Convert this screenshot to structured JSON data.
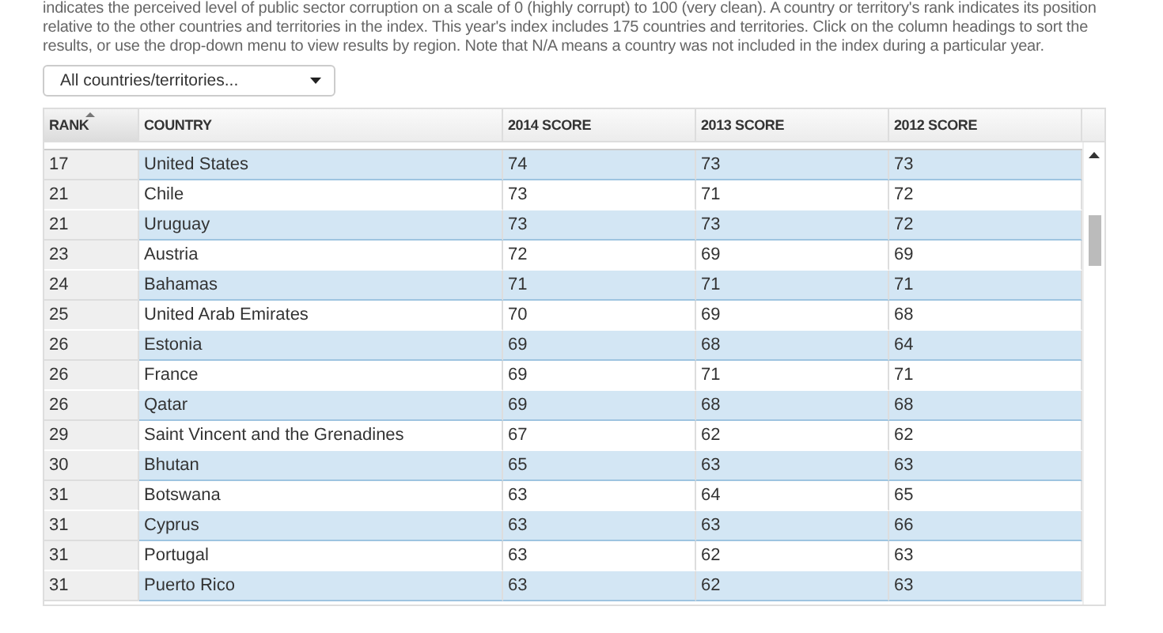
{
  "intro": "indicates the perceived level of public sector corruption on a scale of 0 (highly corrupt) to 100 (very clean). A country or territory's rank indicates its position relative to the other countries and territories in the index. This year's index includes 175 countries and territories. Click on the column headings to sort the results, or use the drop-down menu to view results by region. Note that N/A means a country was not included in the index during a particular year.",
  "region_select": {
    "value": "All countries/territories..."
  },
  "table": {
    "columns": [
      {
        "label": "RANK",
        "sorted": true
      },
      {
        "label": "COUNTRY",
        "sorted": false
      },
      {
        "label": "2014 SCORE",
        "sorted": false
      },
      {
        "label": "2013 SCORE",
        "sorted": false
      },
      {
        "label": "2012 SCORE",
        "sorted": false
      }
    ],
    "rows": [
      [
        "17",
        "United States",
        "74",
        "73",
        "73"
      ],
      [
        "21",
        "Chile",
        "73",
        "71",
        "72"
      ],
      [
        "21",
        "Uruguay",
        "73",
        "73",
        "72"
      ],
      [
        "23",
        "Austria",
        "72",
        "69",
        "69"
      ],
      [
        "24",
        "Bahamas",
        "71",
        "71",
        "71"
      ],
      [
        "25",
        "United Arab Emirates",
        "70",
        "69",
        "68"
      ],
      [
        "26",
        "Estonia",
        "69",
        "68",
        "64"
      ],
      [
        "26",
        "France",
        "69",
        "71",
        "71"
      ],
      [
        "26",
        "Qatar",
        "69",
        "68",
        "68"
      ],
      [
        "29",
        "Saint Vincent and the Grenadines",
        "67",
        "62",
        "62"
      ],
      [
        "30",
        "Bhutan",
        "65",
        "63",
        "63"
      ],
      [
        "31",
        "Botswana",
        "63",
        "64",
        "65"
      ],
      [
        "31",
        "Cyprus",
        "63",
        "63",
        "66"
      ],
      [
        "31",
        "Portugal",
        "63",
        "62",
        "63"
      ],
      [
        "31",
        "Puerto Rico",
        "63",
        "62",
        "63"
      ]
    ]
  }
}
